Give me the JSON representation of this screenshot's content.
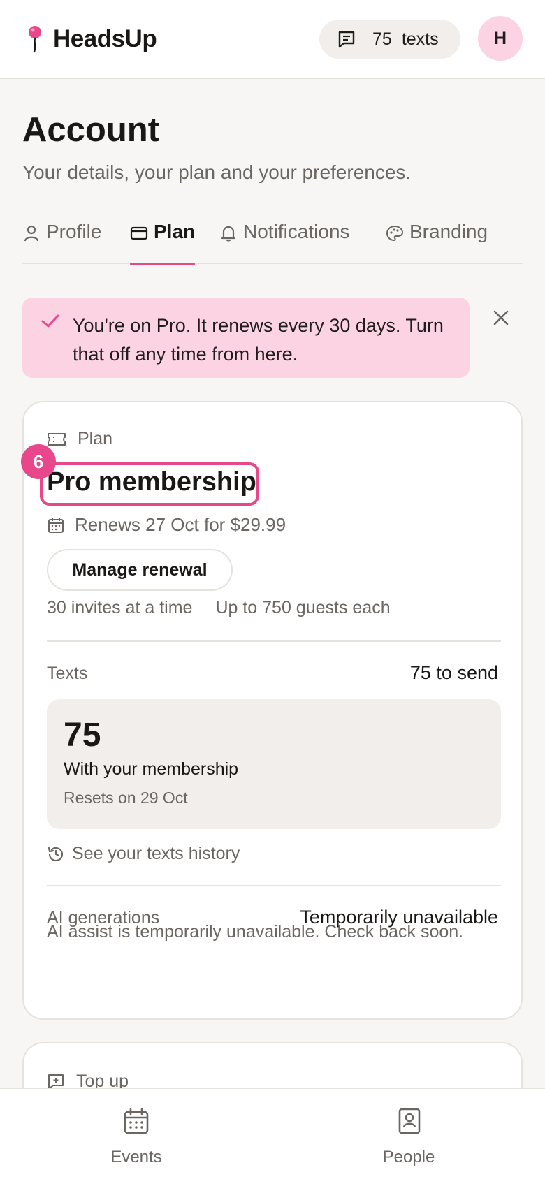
{
  "header": {
    "brand": "HeadsUp",
    "texts_count": "75",
    "texts_label": "texts",
    "avatar_initial": "H",
    "accent_color": "#e8478b"
  },
  "page": {
    "title": "Account",
    "subtitle": "Your details, your plan and your preferences."
  },
  "tabs": [
    {
      "label": "Profile",
      "icon": "person-icon",
      "active": false
    },
    {
      "label": "Plan",
      "icon": "card-icon",
      "active": true
    },
    {
      "label": "Notifications",
      "icon": "bell-icon",
      "active": false
    },
    {
      "label": "Branding",
      "icon": "palette-icon",
      "active": false
    }
  ],
  "banner": {
    "message": "You're on Pro. It renews every 30 days. Turn that off any time from here."
  },
  "plan_card": {
    "label": "Plan",
    "name": "Pro membership",
    "step_badge": "6",
    "renews": "Renews 27 Oct for $29.99",
    "manage_button": "Manage renewal",
    "limit_invites": "30 invites at a time",
    "limit_guests": "Up to 750 guests each",
    "texts_label": "Texts",
    "texts_value": "75 to send",
    "texts_box": {
      "count": "75",
      "source": "With your membership",
      "reset": "Resets on 29 Oct"
    },
    "history_link": "See your texts history",
    "ai_label": "AI generations",
    "ai_value": "Temporarily unavailable",
    "ai_note": "AI assist is temporarily unavailable. Check back soon."
  },
  "topup_card": {
    "label": "Top up"
  },
  "bottom_nav": {
    "events": "Events",
    "people": "People"
  }
}
